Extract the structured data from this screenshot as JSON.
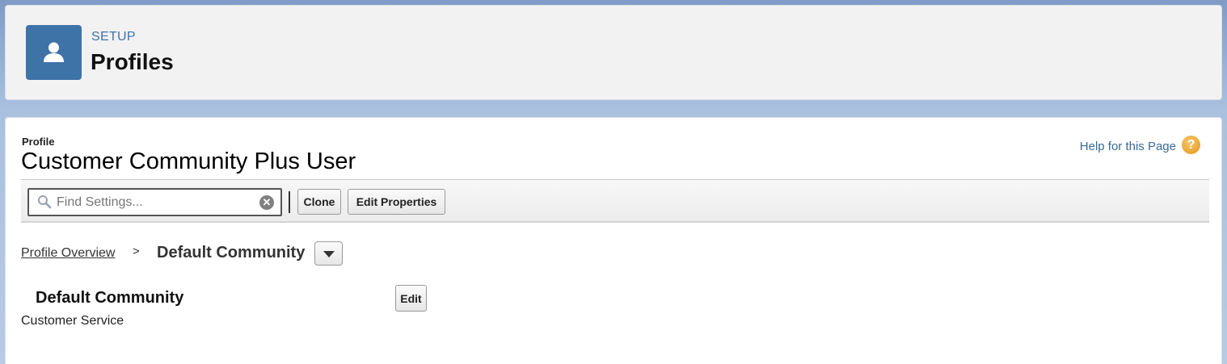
{
  "header": {
    "eyebrow": "SETUP",
    "title": "Profiles",
    "icon": "user-icon",
    "icon_color": "#3e73a8"
  },
  "profile": {
    "label": "Profile",
    "name": "Customer Community Plus User"
  },
  "help": {
    "link_text": "Help for this Page",
    "icon": "help-question-icon",
    "icon_glyph": "?"
  },
  "toolbar": {
    "search_placeholder": "Find Settings...",
    "search_value": "",
    "clear_glyph": "✕",
    "clone_label": "Clone",
    "edit_properties_label": "Edit Properties"
  },
  "breadcrumb": {
    "parent_label": "Profile Overview",
    "separator": ">",
    "current_label": "Default Community"
  },
  "section": {
    "title": "Default Community",
    "edit_label": "Edit",
    "value": "Customer Service"
  }
}
